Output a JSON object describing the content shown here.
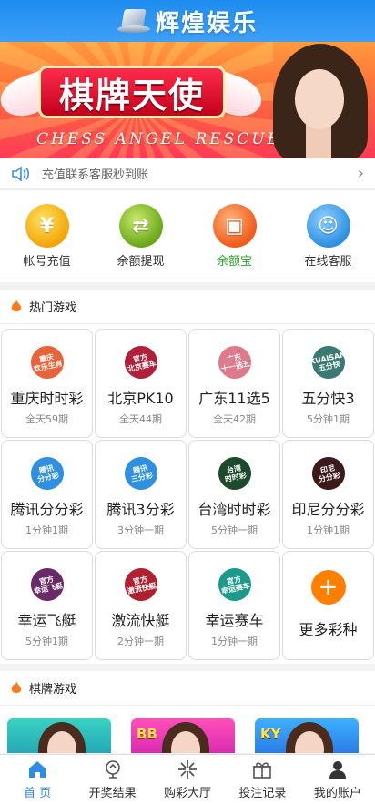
{
  "header": {
    "title": "辉煌娱乐"
  },
  "banner": {
    "title": "棋牌天使",
    "subtitle": "CHESS ANGEL RESCUE"
  },
  "notice": {
    "text": "充值联系客服秒到账"
  },
  "quick": [
    {
      "label": "帐号充值",
      "icon": "gold-coin-icon"
    },
    {
      "label": "余额提现",
      "icon": "coin-exchange-icon"
    },
    {
      "label": "余额宝",
      "icon": "gift-box-icon",
      "color": "#2ea52e"
    },
    {
      "label": "在线客服",
      "icon": "customer-service-icon"
    }
  ],
  "hot": {
    "title": "热门游戏",
    "games": [
      {
        "name": "重庆时时彩",
        "freq": "全天59期",
        "badge": "重庆\n欢乐生肖",
        "color": "#e8633a"
      },
      {
        "name": "北京PK10",
        "freq": "全天44期",
        "badge": "官方\n北京赛车",
        "color": "#b0203a"
      },
      {
        "name": "广东11选5",
        "freq": "全天42期",
        "badge": "广东\n十一选五",
        "color": "#e07a8a"
      },
      {
        "name": "五分快3",
        "freq": "5分钟1期",
        "badge": "KUAISAN\n五分快",
        "color": "#3a7a72"
      },
      {
        "name": "腾讯分分彩",
        "freq": "1分钟1期",
        "badge": "腾讯\n分分彩",
        "color": "#2f8fe0"
      },
      {
        "name": "腾讯3分彩",
        "freq": "3分钟一期",
        "badge": "腾讯\n三分彩",
        "color": "#2f8fe0"
      },
      {
        "name": "台湾时时彩",
        "freq": "5分钟一期",
        "badge": "台湾\n时时彩",
        "color": "#1d4a2a"
      },
      {
        "name": "印尼分分彩",
        "freq": "1分钟1期",
        "badge": "印尼\n分分彩",
        "color": "#3a1a1a"
      },
      {
        "name": "幸运飞艇",
        "freq": "5分钟1期",
        "badge": "官方\n幸运飞艇",
        "color": "#6a2a6a"
      },
      {
        "name": "激流快艇",
        "freq": "2分钟一期",
        "badge": "官方\n激流快艇",
        "color": "#b02030"
      },
      {
        "name": "幸运赛车",
        "freq": "1分钟一期",
        "badge": "官方\n幸运赛车",
        "color": "#1a9a8a"
      }
    ],
    "more_label": "更多彩种"
  },
  "cards_section": {
    "title": "棋牌游戏",
    "cards": [
      {
        "tag": ""
      },
      {
        "tag": "BB"
      },
      {
        "tag": "KY"
      }
    ]
  },
  "tabs": [
    {
      "label": "首 页",
      "icon": "home-icon",
      "active": true
    },
    {
      "label": "开奖结果",
      "icon": "trophy-icon"
    },
    {
      "label": "购彩大厅",
      "icon": "star-burst-icon"
    },
    {
      "label": "投注记录",
      "icon": "gift-icon"
    },
    {
      "label": "我的账户",
      "icon": "user-icon"
    }
  ],
  "colors": {
    "primary": "#2d8ce8",
    "accent_orange": "#ff7f00",
    "green": "#2ea52e"
  }
}
